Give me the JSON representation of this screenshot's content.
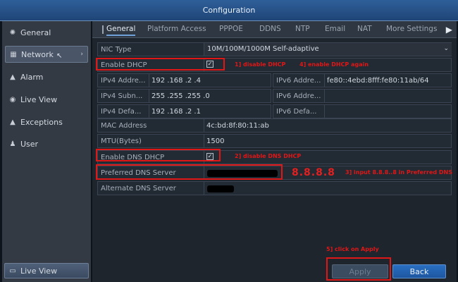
{
  "window": {
    "title": "Configuration"
  },
  "sidebar": {
    "items": [
      {
        "label": "General",
        "icon": "gear-icon",
        "glyph": "✺"
      },
      {
        "label": "Network",
        "icon": "network-icon",
        "glyph": "▦"
      },
      {
        "label": "Alarm",
        "icon": "alarm-icon",
        "glyph": "▲"
      },
      {
        "label": "Live View",
        "icon": "eye-icon",
        "glyph": "◉"
      },
      {
        "label": "Exceptions",
        "icon": "warning-icon",
        "glyph": "▲"
      },
      {
        "label": "User",
        "icon": "users-icon",
        "glyph": "♟"
      }
    ],
    "active": "Network",
    "bottom_label": "Live View"
  },
  "tabs": [
    "General",
    "Platform Access",
    "PPPOE",
    "DDNS",
    "NTP",
    "Email",
    "NAT",
    "More Settings"
  ],
  "active_tab": "General",
  "form": {
    "nic_type_label": "NIC Type",
    "nic_type_value": "10M/100M/1000M Self-adaptive",
    "enable_dhcp_label": "Enable DHCP",
    "enable_dhcp_checked": true,
    "ipv4_address_label": "IPv4 Addre...",
    "ipv4_address_value": "192 .168 .2    .4",
    "ipv4_subnet_label": "IPv4 Subn...",
    "ipv4_subnet_value": "255 .255 .255 .0",
    "ipv4_gateway_label": "IPv4 Defa...",
    "ipv4_gateway_value": "192 .168 .2    .1",
    "ipv6_address1_label": "IPv6 Addre...",
    "ipv6_address1_value": "fe80::4ebd:8fff:fe80:11ab/64",
    "ipv6_address2_label": "IPv6 Addre...",
    "ipv6_gateway_label": "IPv6 Defa...",
    "mac_label": "MAC Address",
    "mac_value": "4c:bd:8f:80:11:ab",
    "mtu_label": "MTU(Bytes)",
    "mtu_value": "1500",
    "enable_dns_dhcp_label": "Enable DNS DHCP",
    "enable_dns_dhcp_checked": true,
    "preferred_dns_label": "Preferred DNS Server",
    "alternate_dns_label": "Alternate DNS Server"
  },
  "annotations": {
    "note1": "1] disable DHCP",
    "note2": "2] disable DNS DHCP",
    "note3": "3] input 8.8.8..8 in Preferred DNS",
    "note4": "4] enable DHCP again",
    "note5": "5] click on Apply",
    "dns_value": "8.8.8.8"
  },
  "buttons": {
    "apply": "Apply",
    "back": "Back"
  },
  "checkmark": "✓"
}
